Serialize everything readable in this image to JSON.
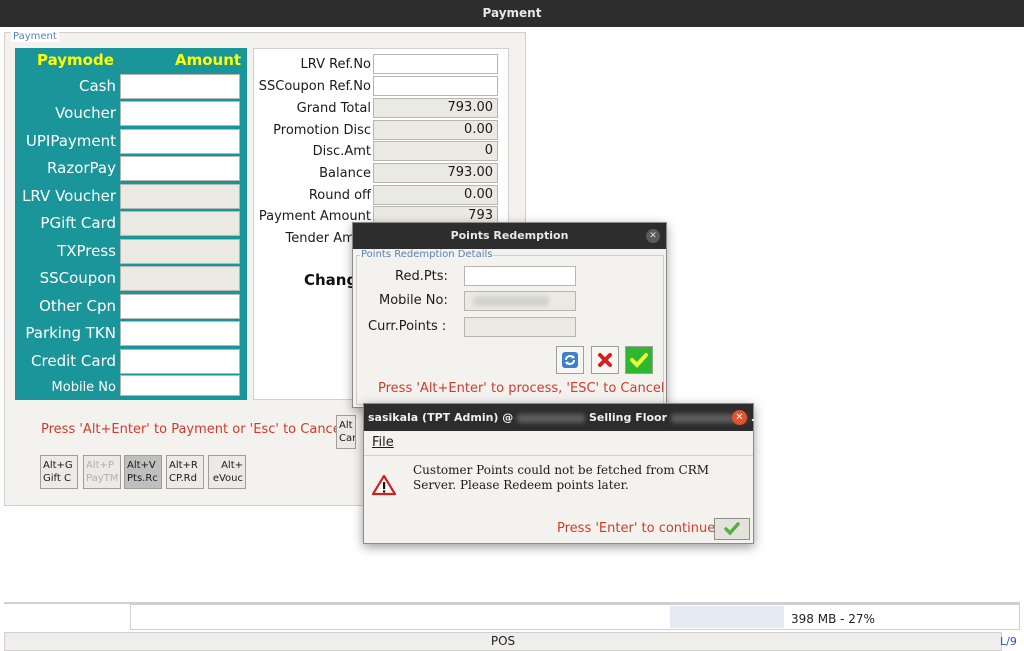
{
  "window": {
    "title": "Payment"
  },
  "payment": {
    "group_title": "Payment",
    "header": {
      "paymode": "Paymode",
      "amount": "Amount"
    },
    "modes": [
      {
        "label": "Cash"
      },
      {
        "label": "Voucher"
      },
      {
        "label": "UPIPayment"
      },
      {
        "label": "RazorPay"
      },
      {
        "label": "LRV Voucher"
      },
      {
        "label": "PGift Card"
      },
      {
        "label": "TXPress"
      },
      {
        "label": "SSCoupon"
      },
      {
        "label": "Other Cpn"
      },
      {
        "label": "Parking TKN"
      },
      {
        "label": "Credit Card"
      },
      {
        "label": "Mobile No"
      }
    ],
    "totals": [
      {
        "label": "LRV Ref.No",
        "value": ""
      },
      {
        "label": "SSCoupon Ref.No",
        "value": ""
      },
      {
        "label": "Grand Total",
        "value": "793.00"
      },
      {
        "label": "Promotion Disc",
        "value": "0.00"
      },
      {
        "label": "Disc.Amt",
        "value": "0"
      },
      {
        "label": "Balance",
        "value": "793.00"
      },
      {
        "label": "Round off",
        "value": "0.00"
      },
      {
        "label": "Payment Amount",
        "value": "793"
      },
      {
        "label": "Tender Amou",
        "value": ""
      }
    ],
    "change_label": "Chang",
    "hint": "Press 'Alt+Enter' to Payment or 'Esc' to Cancel",
    "shortcut_buttons": [
      {
        "line1": "Alt+G",
        "line2": "Gift C"
      },
      {
        "line1": "Alt+P",
        "line2": "PayTM"
      },
      {
        "line1": "Alt+V",
        "line2": "Pts.Rc"
      },
      {
        "line1": "Alt+R",
        "line2": "CP.Rd"
      },
      {
        "line1": "Alt+",
        "line2": "eVouc"
      }
    ],
    "partial_button": {
      "line1": "Alt",
      "line2": "Car"
    }
  },
  "points_dialog": {
    "title": "Points Redemption",
    "group_title": "Points Redemption Details",
    "red_pts_label": "Red.Pts:",
    "mobile_label": "Mobile No:",
    "curr_points_label": "Curr.Points :",
    "hint": "Press 'Alt+Enter' to process, 'ESC' to Cancel"
  },
  "error_dialog": {
    "title_user": "sasikala (TPT Admin) @",
    "title_location": "Selling Floor",
    "title_tail": ".",
    "menu_file": "File",
    "message": "Customer Points could not be fetched from CRM Server. Please Redeem points later.",
    "hint": "Press 'Enter' to continue"
  },
  "status": {
    "memory": "398 MB - 27%",
    "app": "POS",
    "page": "L/9"
  },
  "colors": {
    "teal": "#1a959a",
    "header_yellow": "#ffff00",
    "hint_red": "#d23a2a",
    "titlebar": "#2d2d2d"
  }
}
